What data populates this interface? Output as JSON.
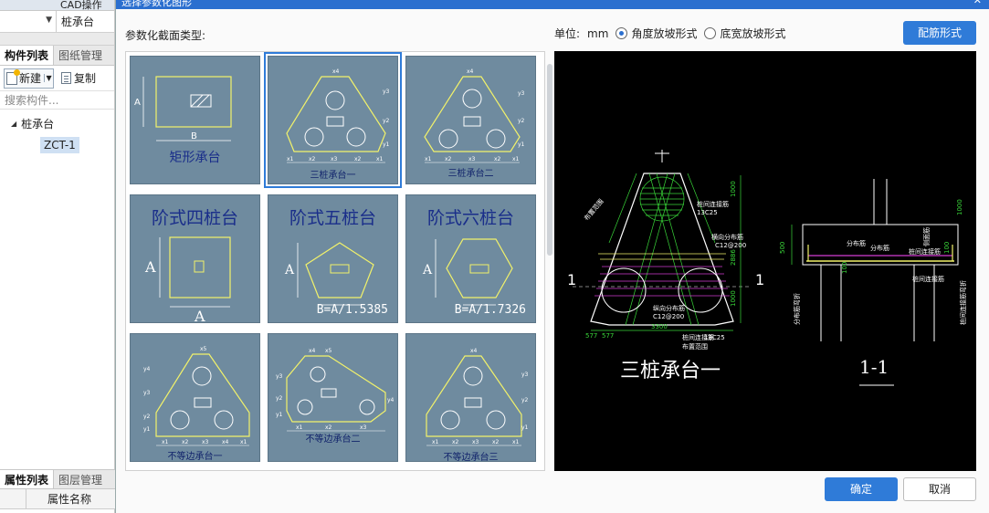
{
  "left_panel": {
    "top_label": "CAD操作",
    "combo_value": "桩承台",
    "tabs": [
      "构件列表",
      "图纸管理"
    ],
    "toolbar": {
      "new_label": "新建",
      "copy_label": "复制"
    },
    "search_placeholder": "搜索构件...",
    "tree_root": "桩承台",
    "tree_child": "ZCT-1",
    "bottom_tabs": [
      "属性列表",
      "图层管理"
    ],
    "prop_header": "属性名称"
  },
  "dialog": {
    "title": "选择参数化图形",
    "section_label": "参数化截面类型:",
    "unit_label": "单位:",
    "unit_value": "mm",
    "radio_angle": "角度放坡形式",
    "radio_width": "底宽放坡形式",
    "peijin_button": "配筋形式",
    "ok_button": "确定",
    "cancel_button": "取消"
  },
  "shapes": [
    {
      "label": "矩形承台"
    },
    {
      "label": "三桩承台一"
    },
    {
      "label": "三桩承台二"
    },
    {
      "label": "阶式四桩台",
      "formula": ""
    },
    {
      "label": "阶式五桩台",
      "formula": "B=A/1.5385"
    },
    {
      "label": "阶式六桩台",
      "formula": "B=A/1.7326"
    },
    {
      "label": "不等边承台一"
    },
    {
      "label": "不等边承台二"
    },
    {
      "label": "不等边承台三"
    }
  ],
  "dims": {
    "A": "A",
    "B": "B",
    "x1": "x1",
    "x2": "x2",
    "x3": "x3",
    "x4": "x4",
    "x5": "x5",
    "y1": "y1",
    "y2": "y2",
    "y3": "y3",
    "y4": "y4"
  },
  "preview": {
    "title_plan": "三桩承台一",
    "title_section": "1-1",
    "section_mark": "1",
    "dims": {
      "d1000a": "1000",
      "d1000b": "1000",
      "d2886": "2886",
      "d3300": "3300",
      "d577a": "577",
      "d577b": "577",
      "d500": "500",
      "d1000c": "1000",
      "d100a": "100",
      "d100b": "100"
    },
    "notes": {
      "n1": "桩间连接筋",
      "n2": "13C25",
      "n3": "横向分布筋",
      "n4": "C12@200",
      "n5": "布置范围",
      "n6": "纵向分布筋",
      "n7": "C12@200",
      "n8": "桩间连接筋",
      "n9": "13C25",
      "n10": "布置范围",
      "n11": "分布筋",
      "n12": "分布筋",
      "n13": "桩间连接筋",
      "n14": "侧面筋",
      "n15": "桩间连接筋",
      "n16": "分布筋弯折",
      "n17": "桩间连接筋弯折"
    }
  },
  "colors": {
    "accent": "#2f7bd8",
    "cell_bg": "#6f8b9f",
    "outline_yellow": "#f2f26a",
    "cad_green": "#39d639",
    "cad_magenta": "#d23cd2"
  }
}
